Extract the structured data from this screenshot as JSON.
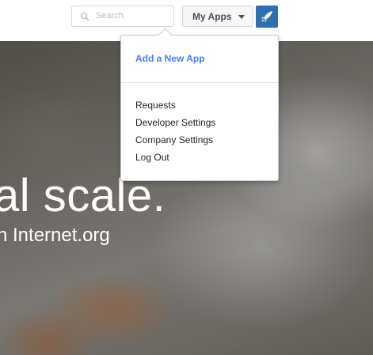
{
  "header": {
    "search_placeholder": "Search",
    "my_apps_label": "My Apps"
  },
  "hero": {
    "headline": "al scale.",
    "subheadline": "h Internet.org"
  },
  "dropdown": {
    "add_app_label": "Add a New App",
    "items": [
      {
        "label": "Requests"
      },
      {
        "label": "Developer Settings"
      },
      {
        "label": "Company Settings"
      },
      {
        "label": "Log Out"
      }
    ]
  },
  "colors": {
    "accent_link": "#4080ff",
    "account_button": "#2d6fb1"
  },
  "icons": {
    "search": "search-icon",
    "caret": "chevron-down-icon",
    "account": "rocket-icon"
  }
}
